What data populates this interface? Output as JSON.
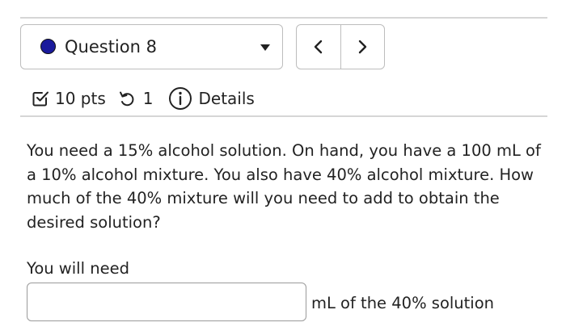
{
  "question_selector": {
    "label": "Question 8",
    "status_color": "#1a1a9c"
  },
  "nav": {
    "prev_icon": "chevron-left-icon",
    "next_icon": "chevron-right-icon"
  },
  "meta": {
    "points": "10 pts",
    "attempts": "1",
    "details": "Details",
    "icons": [
      "checkbox-icon",
      "retry-icon",
      "info-icon"
    ]
  },
  "question": {
    "text": "You need a 15% alcohol solution. On hand, you have a 100 mL of a 10% alcohol mixture. You also have 40% alcohol mixture. How much of the 40% mixture will you need to add to obtain the desired solution?"
  },
  "answer": {
    "prompt": "You will need",
    "value": "",
    "placeholder": "",
    "unit_label": "mL of the 40% solution"
  }
}
